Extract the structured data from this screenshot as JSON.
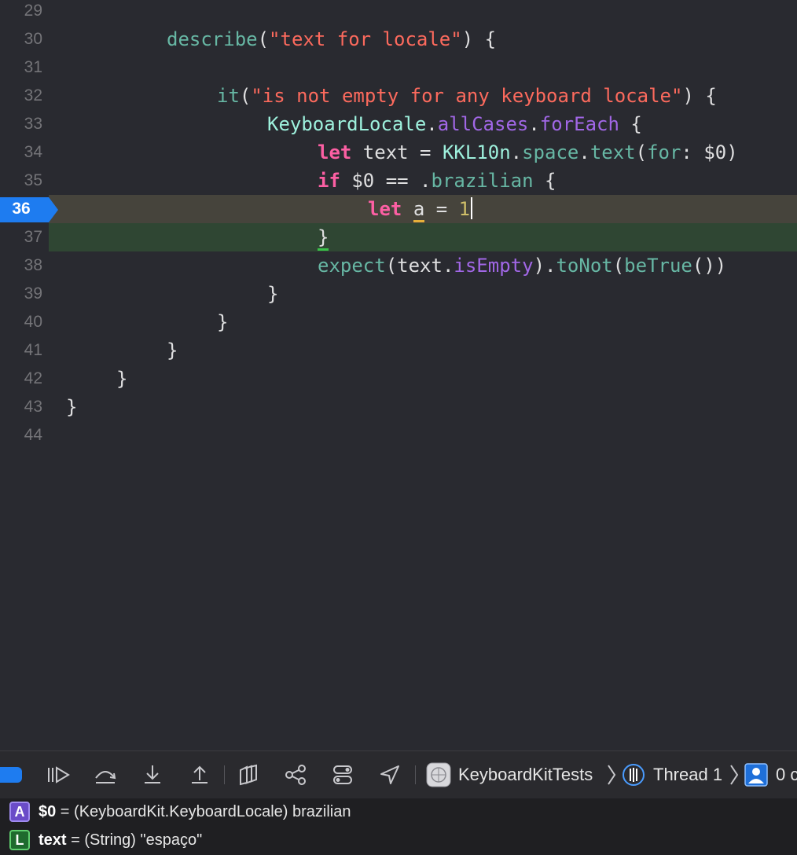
{
  "editor": {
    "line_numbers": [
      "29",
      "30",
      "31",
      "32",
      "33",
      "34",
      "35",
      "36",
      "37",
      "38",
      "39",
      "40",
      "41",
      "42",
      "43",
      "44"
    ],
    "current_line": "36",
    "lines": {
      "l30": {
        "describe": "describe",
        "open": "(",
        "str": "\"text for locale\"",
        "close": ") {"
      },
      "l32": {
        "it": "it",
        "open": "(",
        "str": "\"is not empty for any keyboard locale\"",
        "close": ") {"
      },
      "l33": {
        "type": "KeyboardLocale",
        "dot1": ".",
        "allCases": "allCases",
        "dot2": ".",
        "forEach": "forEach",
        "brace": " {"
      },
      "l34": {
        "let": "let",
        "mid": " text = ",
        "type": "KKL10n",
        "dot1": ".",
        "space": "space",
        "dot2": ".",
        "text": "text",
        "open": "(",
        "for": "for",
        "rest": ": $0)"
      },
      "l35": {
        "if": "if",
        "rest": " $0 == .",
        "brazilian": "brazilian",
        "brace": " {"
      },
      "l36": {
        "let": "let",
        "sp": " ",
        "a": "a",
        "eq": " = ",
        "one": "1"
      },
      "l37": {
        "brace": "}"
      },
      "l38": {
        "expect": "expect",
        "open": "(text.",
        "isEmpty": "isEmpty",
        "close": ").",
        "toNot": "toNot",
        "open2": "(",
        "beTrue": "beTrue",
        "close2": "())"
      },
      "l39": {
        "brace": "}"
      },
      "l40": {
        "brace": "}"
      },
      "l41": {
        "brace": "}"
      },
      "l42": {
        "brace": "}"
      },
      "l43": {
        "brace": "}"
      }
    }
  },
  "debug_bar": {
    "scheme": "KeyboardKitTests",
    "thread": "Thread 1",
    "frame": "0 c"
  },
  "variables": [
    {
      "badge": "A",
      "name": "$0",
      "eq": " = ",
      "type": "(KeyboardKit.KeyboardLocale)",
      "value": " brazilian"
    },
    {
      "badge": "L",
      "name": "text",
      "eq": " = ",
      "type": "(String)",
      "value": " \"espaço\""
    }
  ],
  "colors": {
    "background": "#292a30",
    "current_line": "#46443c",
    "green_line": "#2f4633",
    "breakpoint": "#1e7cf0",
    "keyword": "#fc5fa3",
    "string": "#fc6a5d"
  }
}
